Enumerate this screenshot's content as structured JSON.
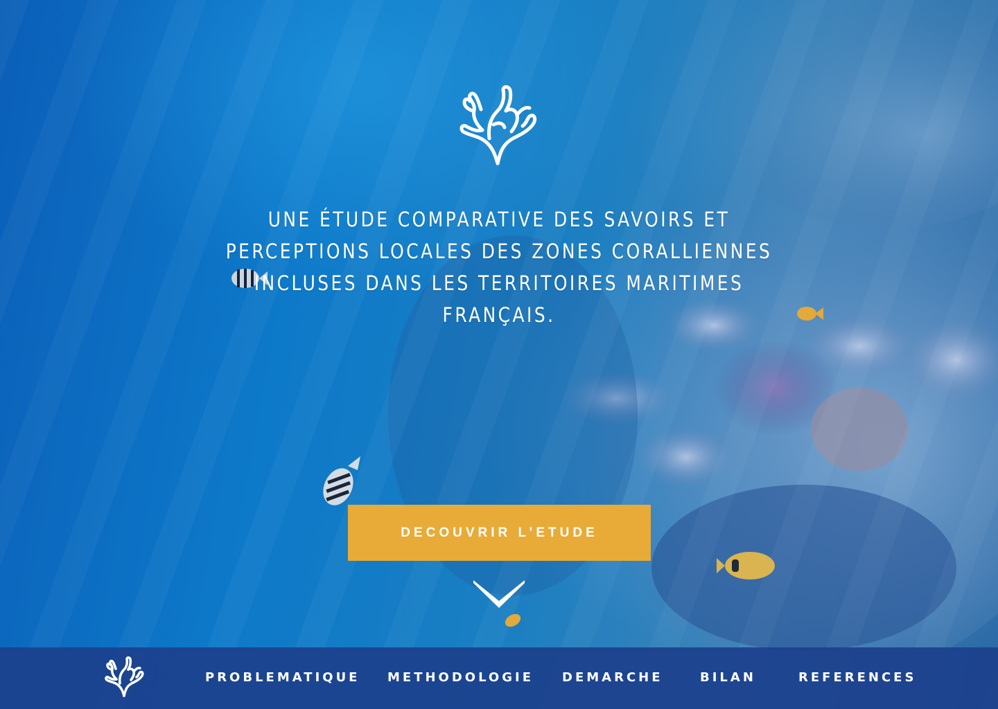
{
  "hero": {
    "headline": "UNE ÉTUDE COMPARATIVE DES SAVOIRS ET PERCEPTIONS LOCALES DES ZONES CORALLIENNES INCLUSES DANS LES TERRITOIRES MARITIMES FRANÇAIS.",
    "cta_label": "DECOUVRIR L’ETUDE",
    "logo_icon": "coral-icon",
    "scroll_icon": "chevron-down-icon"
  },
  "navbar": {
    "logo_icon": "coral-icon",
    "items": [
      {
        "label": "PROBLEMATIQUE"
      },
      {
        "label": "METHODOLOGIE"
      },
      {
        "label": "DEMARCHE"
      },
      {
        "label": "BILAN"
      },
      {
        "label": "REFERENCES"
      }
    ]
  },
  "colors": {
    "cta_background": "#e8ab38",
    "navbar_background": "#1c408c",
    "text": "#ffffff"
  }
}
